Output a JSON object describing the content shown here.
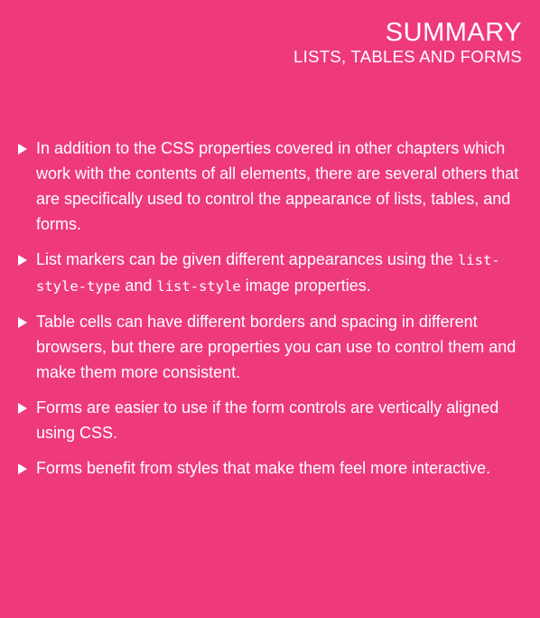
{
  "header": {
    "title": "SUMMARY",
    "subtitle": "LISTS, TABLES AND FORMS"
  },
  "bullets": [
    {
      "text": "In addition to the CSS properties covered in other chapters which work with the contents of all elements, there are several others that are specifically used to control the appearance of lists, tables, and forms."
    },
    {
      "text_before": "List markers can be given different appearances using the ",
      "code1": "list-style-type",
      "text_middle": " and ",
      "code2": "list-style",
      "text_after": " image properties."
    },
    {
      "text": "Table cells can have different borders and spacing in different browsers, but there are properties you can use to control them and make them more consistent."
    },
    {
      "text": "Forms are easier to use if the form controls are vertically aligned using CSS."
    },
    {
      "text": "Forms benefit from styles that make them feel more interactive."
    }
  ],
  "colors": {
    "background": "#ee3a7d",
    "text": "#ffffff"
  },
  "icons": {
    "bullet": "triangle-right-icon"
  }
}
